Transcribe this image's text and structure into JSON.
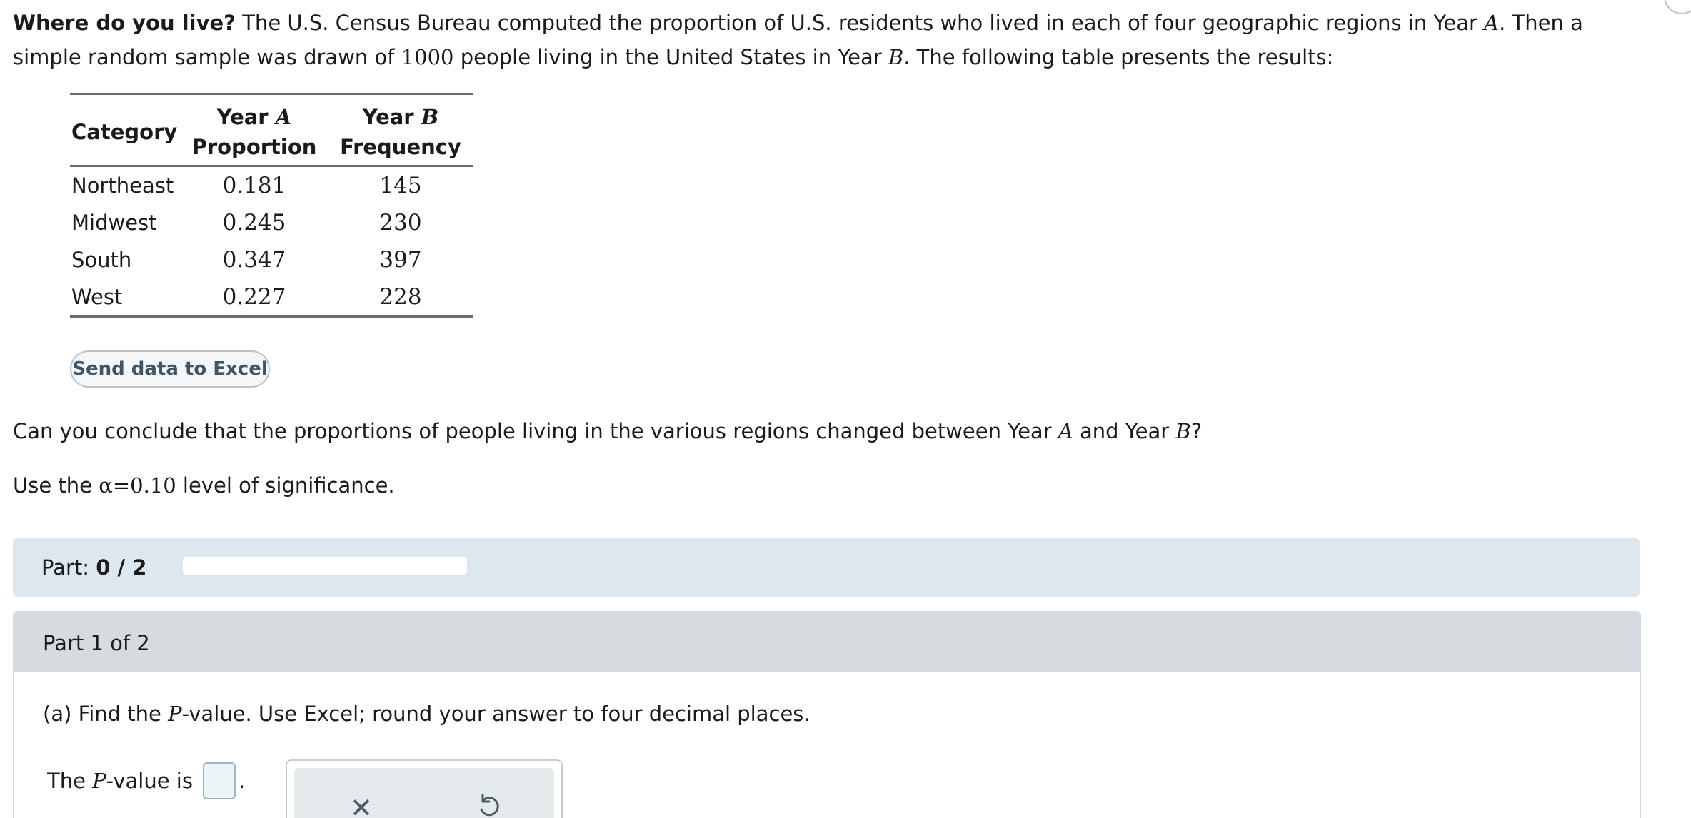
{
  "intro": {
    "bold_lead": "Where do you live?",
    "text1": " The U.S. Census Bureau computed the proportion of U.S. residents who lived in each of four geographic regions in Year ",
    "var_a": "A",
    "text2": ". Then a simple random sample was drawn of ",
    "sample_size": "1000",
    "text3": " people living in the United States in Year ",
    "var_b": "B",
    "text4": ". The following table presents the results:"
  },
  "table": {
    "header_category": "Category",
    "header_year_word": "Year",
    "header_a_var": "A",
    "header_a_sub": "Proportion",
    "header_b_var": "B",
    "header_b_sub": "Frequency",
    "rows": [
      {
        "category": "Northeast",
        "proportion": "0.181",
        "frequency": "145"
      },
      {
        "category": "Midwest",
        "proportion": "0.245",
        "frequency": "230"
      },
      {
        "category": "South",
        "proportion": "0.347",
        "frequency": "397"
      },
      {
        "category": "West",
        "proportion": "0.227",
        "frequency": "228"
      }
    ]
  },
  "excel_button": "Send data to Excel",
  "question": {
    "text1": "Can you conclude that the proportions of people living in the various regions changed between Year ",
    "var_a": "A",
    "text2": " and Year ",
    "var_b": "B",
    "text3": "?"
  },
  "significance": {
    "text1": "Use the ",
    "alpha": "α",
    "equals": "=",
    "value": "0.10",
    "text2": " level of significance."
  },
  "part_bar": {
    "label": "Part: ",
    "progress_text": "0 / 2",
    "progress_fraction": 0
  },
  "part_section": {
    "header": "Part 1 of 2",
    "question_prefix": "(a) Find the ",
    "p_var": "P",
    "question_suffix": "-value. Use Excel; round your answer to four decimal places.",
    "answer_prefix": "The ",
    "answer_suffix": "-value is",
    "answer_period": "."
  },
  "icons": {
    "clear": "close-icon",
    "undo": "undo-icon"
  }
}
